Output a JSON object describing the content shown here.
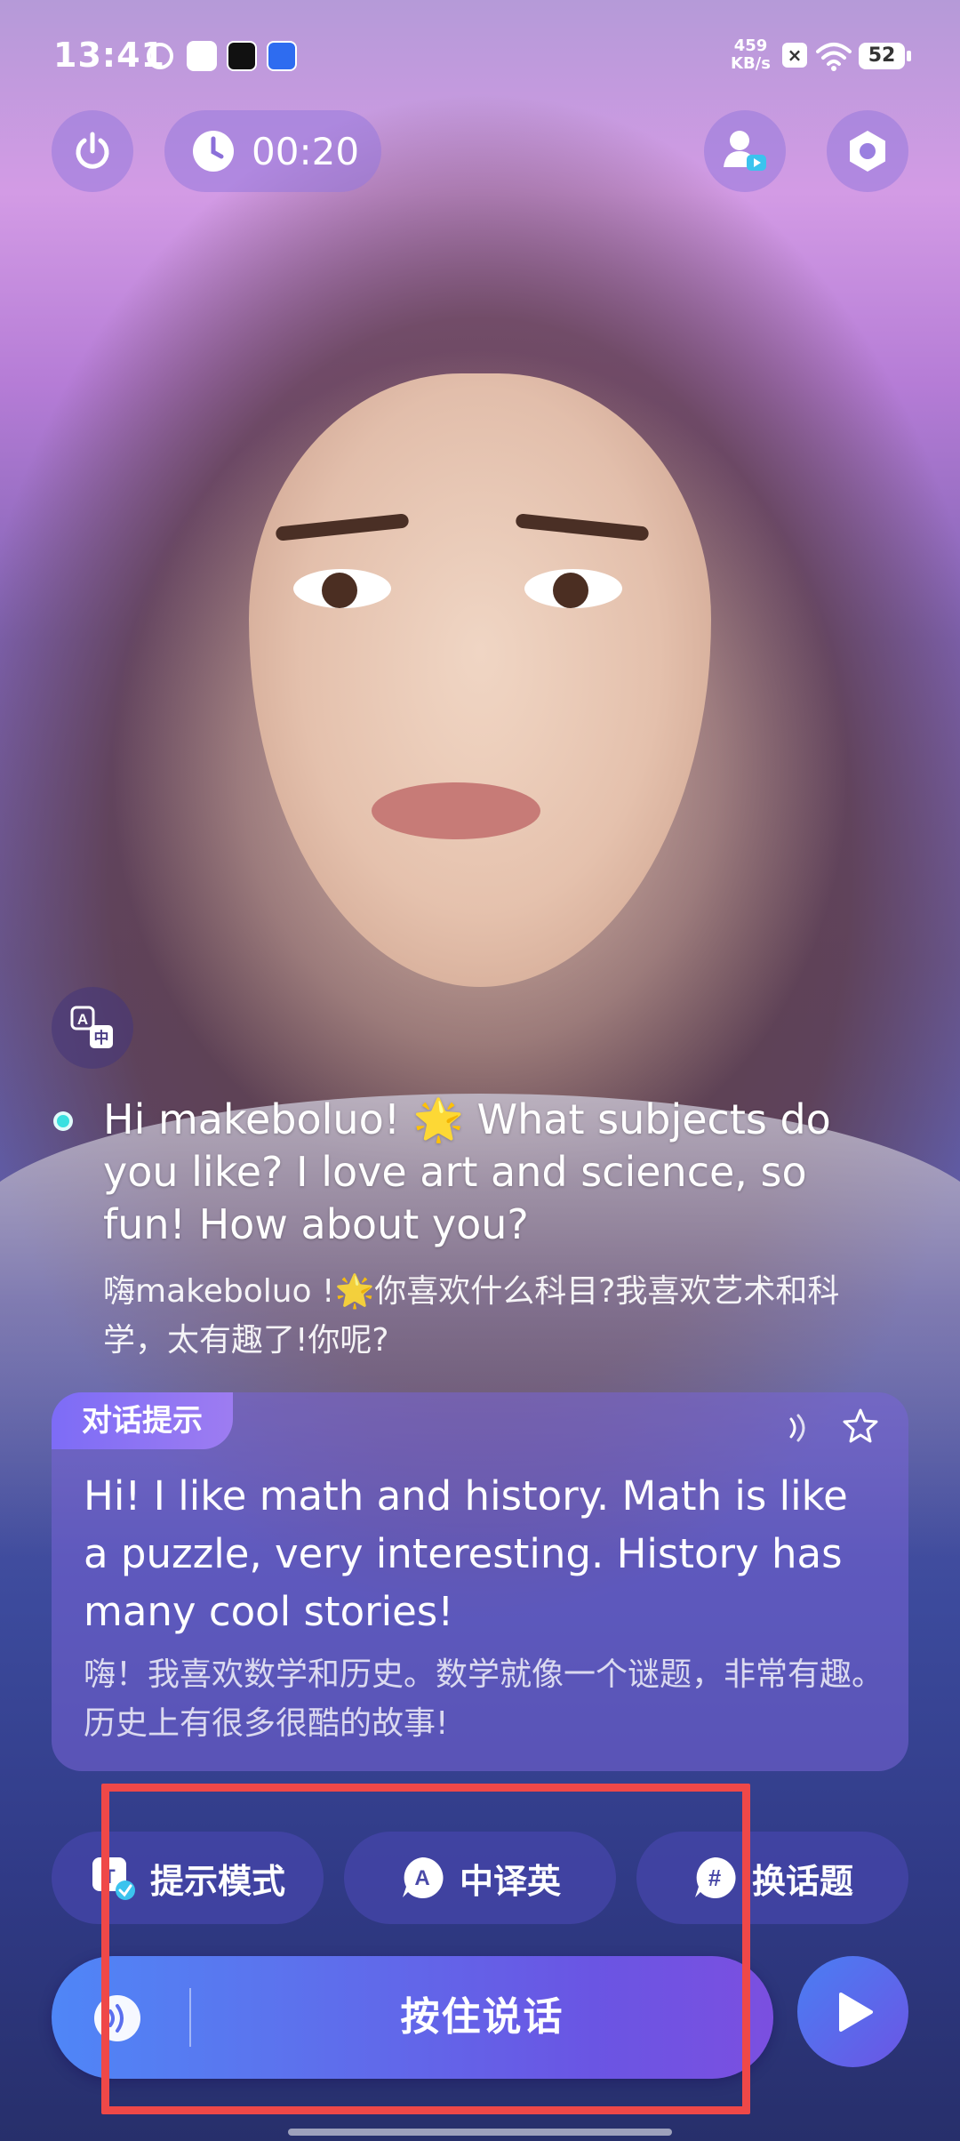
{
  "status_bar": {
    "time": "13:41",
    "net_speed_value": "459",
    "net_speed_unit": "KB/s",
    "battery": "52"
  },
  "top_controls": {
    "timer": "00:20"
  },
  "message": {
    "english": "Hi makeboluo! 🌟 What subjects do you like? I love art and science, so fun! How about you?",
    "chinese": "嗨makeboluo !🌟你喜欢什么科目?我喜欢艺术和科学，太有趣了!你呢?"
  },
  "hint_card": {
    "tag": "对话提示",
    "english": "Hi! I like math and history. Math is like a puzzle, very interesting. History has many cool stories!",
    "chinese": "嗨！我喜欢数学和历史。数学就像一个谜题，非常有趣。历史上有很多很酷的故事!"
  },
  "actions": {
    "hint_mode": "提示模式",
    "translate": "中译英",
    "change_topic": "换话题"
  },
  "talk_bar": {
    "label": "按住说话"
  },
  "colors": {
    "accent_dot": "#39e0e0",
    "talk_gradient_start": "#4f86f7",
    "talk_gradient_end": "#7b4fe0",
    "highlight": "#ef4848"
  }
}
